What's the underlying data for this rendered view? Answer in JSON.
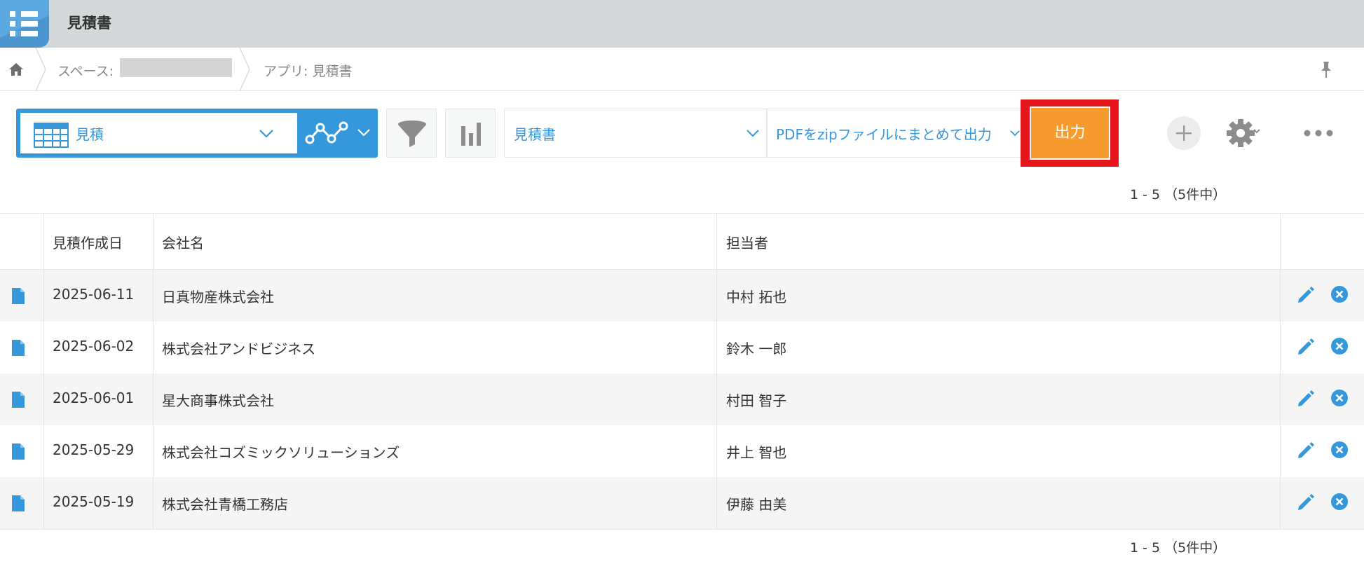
{
  "header": {
    "title": "見積書"
  },
  "breadcrumb": {
    "space_label": "スペース:",
    "app_label": "アプリ: 見積書"
  },
  "toolbar": {
    "view_label": "見積",
    "report_select": "見積書",
    "action_select": "PDFをzipファイルにまとめて出力",
    "output_button": "出力"
  },
  "pager": {
    "top": "1 - 5 （5件中）",
    "bottom": "1 - 5 （5件中）"
  },
  "table": {
    "columns": [
      "見積作成日",
      "会社名",
      "担当者"
    ],
    "rows": [
      {
        "date": "2025-06-11",
        "company": "日真物産株式会社",
        "person": "中村 拓也"
      },
      {
        "date": "2025-06-02",
        "company": "株式会社アンドビジネス",
        "person": "鈴木 一郎"
      },
      {
        "date": "2025-06-01",
        "company": "星大商事株式会社",
        "person": "村田 智子"
      },
      {
        "date": "2025-05-29",
        "company": "株式会社コズミックソリューションズ",
        "person": "井上 智也"
      },
      {
        "date": "2025-05-19",
        "company": "株式会社青橋工務店",
        "person": "伊藤 由美"
      }
    ]
  },
  "colors": {
    "accent": "#3498db",
    "output": "#f89b2f",
    "highlight": "#e6171a"
  },
  "icons": [
    "app-list-icon",
    "home-icon",
    "pin-icon",
    "table-view-icon",
    "chevron-down-icon",
    "graph-icon",
    "filter-icon",
    "bar-chart-icon",
    "plus-icon",
    "gear-icon",
    "more-icon",
    "document-icon",
    "edit-icon",
    "delete-icon"
  ]
}
